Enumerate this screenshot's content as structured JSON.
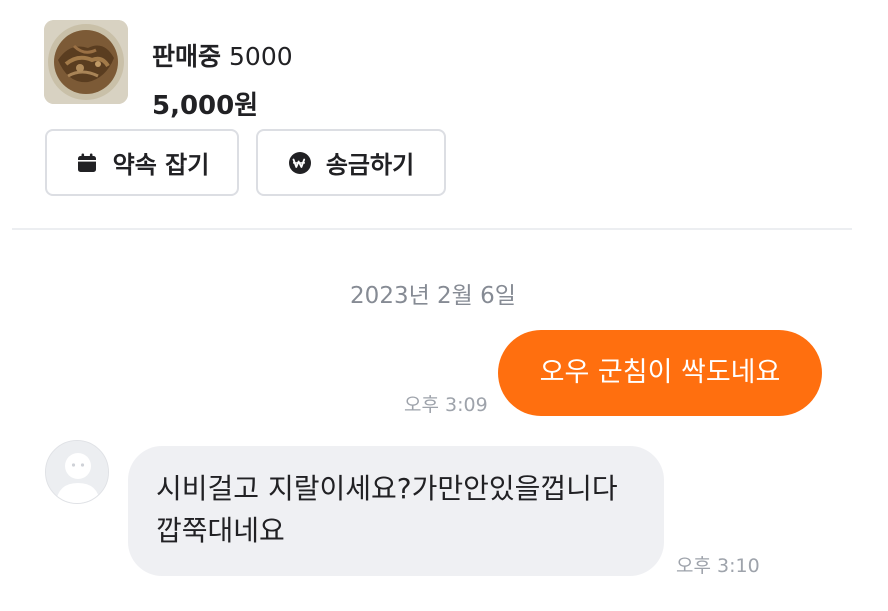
{
  "product": {
    "thumbnail_icon": "product-photo",
    "status": "판매중",
    "title": "5000",
    "price": "5,000원"
  },
  "actions": {
    "appointment": {
      "label": "약속 잡기",
      "icon": "calendar-icon"
    },
    "transfer": {
      "label": "송금하기",
      "icon": "won-coin-icon"
    }
  },
  "chat": {
    "date": "2023년 2월 6일",
    "messages": [
      {
        "direction": "out",
        "text": "오우 군침이 싹도네요",
        "time": "오후 3:09"
      },
      {
        "direction": "in",
        "text": "시비걸고 지랄이세요?가만안있을껍니다 깝쭉대네요",
        "time": "오후 3:10"
      }
    ]
  },
  "colors": {
    "accent": "#ff6f0f",
    "incoming_bubble": "#eff0f3",
    "muted_text": "#868b94"
  }
}
